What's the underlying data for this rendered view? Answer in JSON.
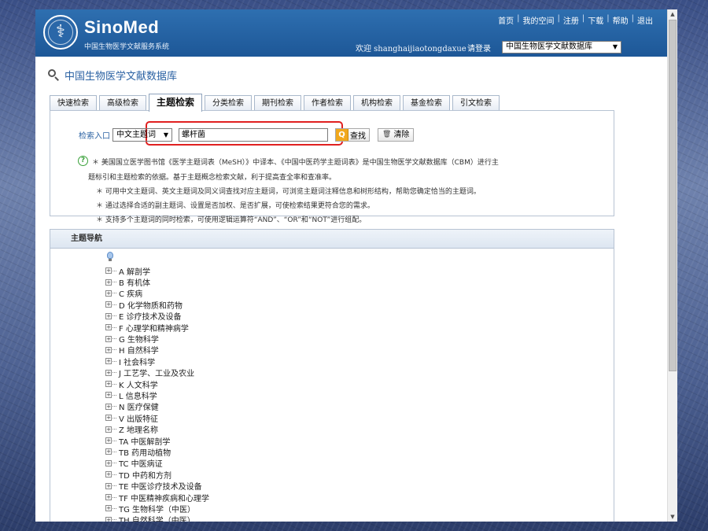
{
  "header": {
    "logo_title": "SinoMed",
    "logo_subtitle": "中国生物医学文献服务系统",
    "top_links": [
      "首页",
      "我的空间",
      "注册",
      "下载",
      "帮助",
      "退出"
    ],
    "welcome": "欢迎 shanghaijiaotongdaxue",
    "login": "请登录",
    "db_select": "中国生物医学文献数据库"
  },
  "title": "中国生物医学文献数据库",
  "tabs": [
    "快速检索",
    "高级检索",
    "主题检索",
    "分类检索",
    "期刊检索",
    "作者检索",
    "机构检索",
    "基金检索",
    "引文检索"
  ],
  "active_tab": "主题检索",
  "search": {
    "entry_label": "检索入口",
    "field_value": "中文主题词",
    "term_value": "螺杆菌",
    "find_label": "查找",
    "clear_label": "清除"
  },
  "notes": {
    "intro_1": "＊ 美国国立医学图书馆《医学主题词表（MeSH）》中译本、《中国中医药学主题词表》是中国生物医学文献数据库（CBM）进行主",
    "intro_2": "题标引和主题检索的依据。基于主题概念检索文献，利于提高查全率和查准率。",
    "bullet_1": "＊ 可用中文主题词、英文主题词及同义词查找对应主题词，可浏览主题词注释信息和树形结构，帮助您确定恰当的主题词。",
    "bullet_2": "＊ 通过选择合适的副主题词、设置是否加权、是否扩展，可使检索结果更符合您的需求。",
    "bullet_3": "＊ 支持多个主题词的同时检索，可使用逻辑运算符“AND”、“OR”和“NOT”进行组配。"
  },
  "nav": {
    "header": "主题导航",
    "items": [
      "A 解剖学",
      "B 有机体",
      "C 疾病",
      "D 化学物质和药物",
      "E 诊疗技术及设备",
      "F 心理学和精神病学",
      "G 生物科学",
      "H 自然科学",
      "I 社会科学",
      "J 工艺学、工业及农业",
      "K 人文科学",
      "L 信息科学",
      "N 医疗保健",
      "V 出版特征",
      "Z 地理名称",
      "TA 中医解剖学",
      "TB 药用动植物",
      "TC 中医病证",
      "TD 中药和方剂",
      "TE 中医诊疗技术及设备",
      "TF 中医精神疾病和心理学",
      "TG 生物科学（中医）",
      "TH 自然科学（中医）"
    ]
  },
  "icons": {
    "search": "search-icon",
    "help": "help-icon",
    "find": "magnifier-icon",
    "clear": "trash-icon",
    "tree_root": "lightbulb-icon",
    "expander": "plus-box-icon"
  },
  "colors": {
    "header_blue": "#1d5797",
    "link_blue": "#2b62a3",
    "highlight_red": "#e02020",
    "help_green": "#3aa13a",
    "find_orange": "#f1a81c"
  }
}
